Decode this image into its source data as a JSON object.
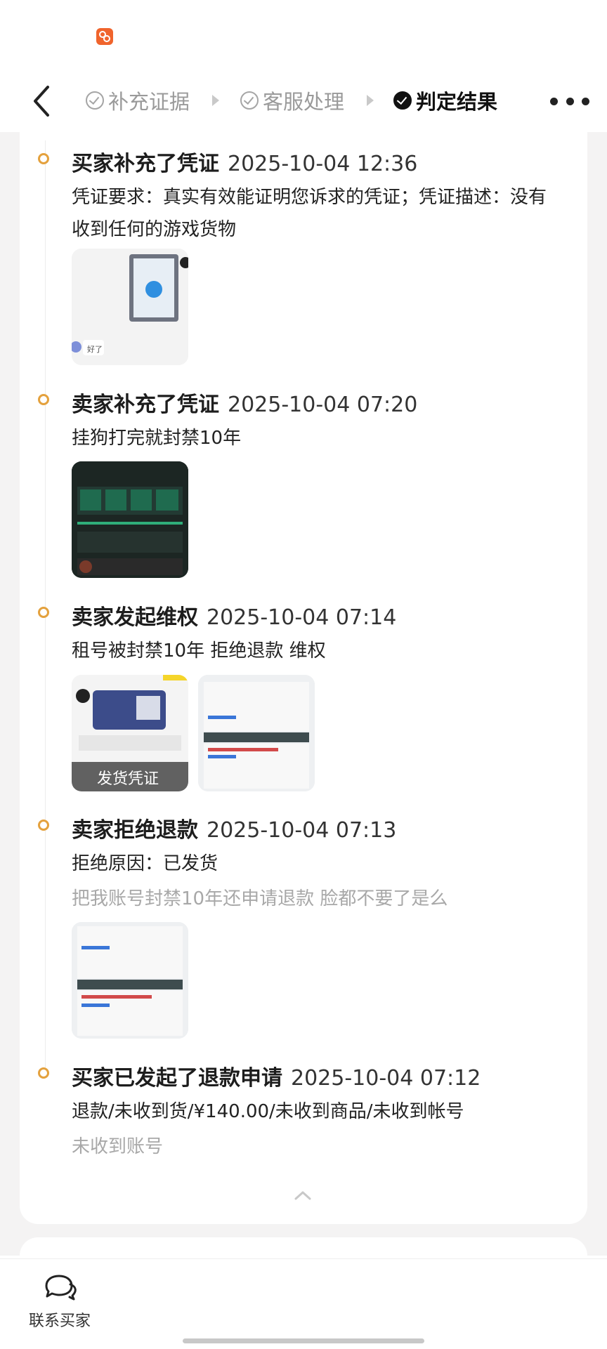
{
  "nav": {
    "steps": [
      {
        "label": "补充证据"
      },
      {
        "label": "客服处理"
      },
      {
        "label": "判定结果"
      }
    ]
  },
  "timeline": [
    {
      "title": "买家补充了凭证",
      "time": "2025-10-04 12:36",
      "desc": "凭证要求：真实有效能证明您诉求的凭证；凭证描述：没有收到任何的游戏货物",
      "thumbs": [
        {
          "caption": "好了"
        }
      ]
    },
    {
      "title": "卖家补充了凭证",
      "time": "2025-10-04 07:20",
      "desc": "挂狗打完就封禁10年",
      "thumbs": [
        {
          "caption": ""
        }
      ]
    },
    {
      "title": "卖家发起维权",
      "time": "2025-10-04 07:14",
      "desc": "租号被封禁10年 拒绝退款 维权",
      "thumbs": [
        {
          "caption": "发货凭证"
        },
        {
          "caption": ""
        }
      ]
    },
    {
      "title": "卖家拒绝退款",
      "time": "2025-10-04 07:13",
      "desc": "拒绝原因：已发货",
      "note": "把我账号封禁10年还申请退款 脸都不要了是么",
      "thumbs": [
        {
          "caption": ""
        }
      ]
    },
    {
      "title": "买家已发起了退款申请",
      "time": "2025-10-04 07:12",
      "desc": "退款/未收到货/¥140.00/未收到商品/未收到帐号",
      "note": "未收到账号"
    }
  ],
  "bottom": {
    "contact_label": "联系买家"
  },
  "colors": {
    "timeline_dot": "#e4a13d",
    "app_icon": "#f0642c",
    "page_bg": "#f4f3f3"
  }
}
